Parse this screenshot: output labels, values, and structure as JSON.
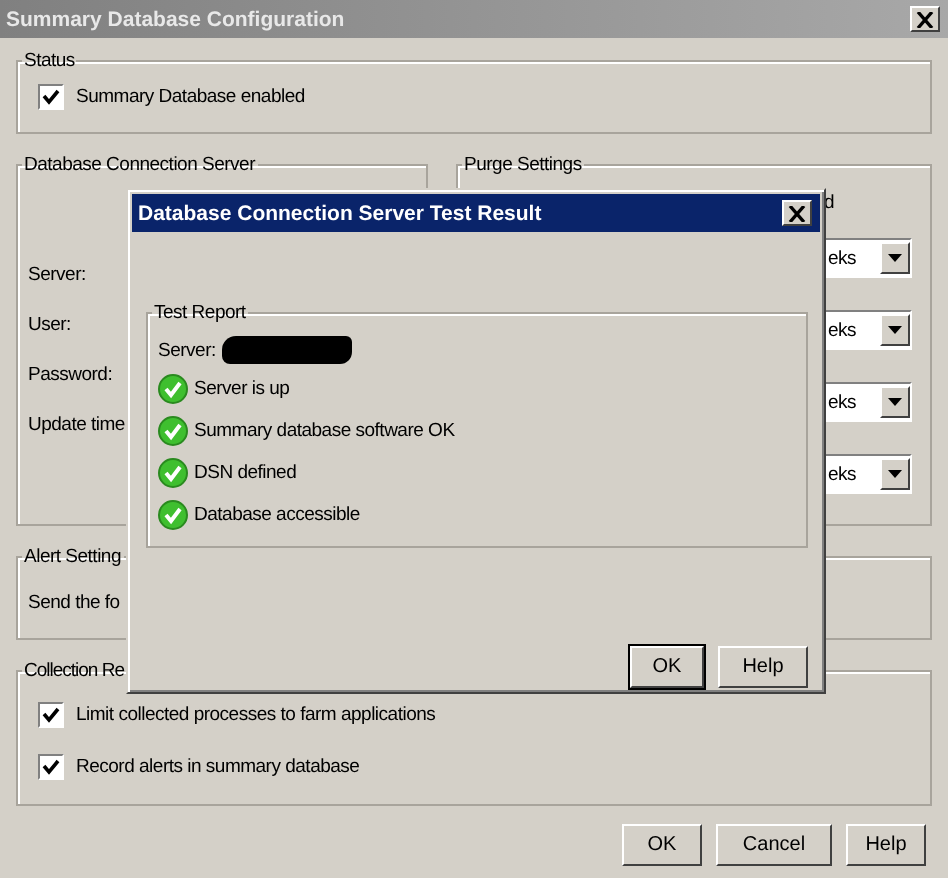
{
  "window": {
    "title": "Summary Database Configuration"
  },
  "status_group": {
    "title": "Status",
    "checkbox": {
      "label": "Summary Database enabled",
      "checked": true
    }
  },
  "connection_group": {
    "title": "Database Connection Server",
    "fields": [
      {
        "label": "Server:"
      },
      {
        "label": "User:"
      },
      {
        "label": "Password:"
      },
      {
        "label": "Update time"
      }
    ]
  },
  "purge_group": {
    "title": "Purge Settings",
    "text": "d",
    "dropdowns": [
      {
        "value": "eks"
      },
      {
        "value": "eks"
      },
      {
        "value": "eks"
      },
      {
        "value": "eks"
      }
    ]
  },
  "alert_group": {
    "title": "Alert Setting",
    "text": "Send the fo"
  },
  "collection_group": {
    "title": "Collection Re",
    "checkboxes": [
      {
        "label": "Limit collected processes to farm applications",
        "checked": true
      },
      {
        "label": "Record alerts in summary database",
        "checked": true
      }
    ]
  },
  "buttons": [
    "OK",
    "Cancel",
    "Help"
  ],
  "dialog": {
    "title": "Database Connection Server Test Result",
    "group_title": "Test Report",
    "server_label": "Server:",
    "redacted": true,
    "checks": [
      {
        "label": "Server is up",
        "passed": true
      },
      {
        "label": "Summary database software OK",
        "passed": true
      },
      {
        "label": "DSN defined",
        "passed": true
      },
      {
        "label": "Database accessible",
        "passed": true
      }
    ],
    "buttons": [
      "OK",
      "Help"
    ]
  }
}
